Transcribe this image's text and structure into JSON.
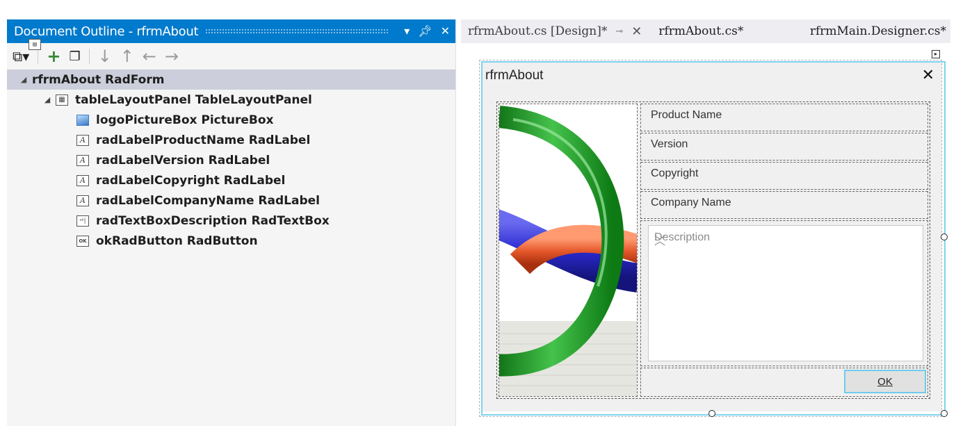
{
  "outline": {
    "title": "Document Outline - rfrmAbout",
    "title_buttons": [
      "dropdown-icon",
      "pin-icon",
      "close-icon"
    ],
    "toolbar": [
      {
        "icon": "view-toggle-icon",
        "enabled": true
      },
      {
        "icon": "add-icon",
        "enabled": true
      },
      {
        "icon": "copy-icon",
        "enabled": true
      },
      {
        "icon": "move-down-icon",
        "enabled": false
      },
      {
        "icon": "move-up-icon",
        "enabled": false
      },
      {
        "icon": "move-left-icon",
        "enabled": false
      },
      {
        "icon": "move-right-icon",
        "enabled": false
      }
    ],
    "tree": [
      {
        "label": "rfrmAbout  RadForm",
        "level": 0,
        "expanded": true,
        "selected": true,
        "icon": "form-icon"
      },
      {
        "label": "tableLayoutPanel  TableLayoutPanel",
        "level": 1,
        "expanded": true,
        "icon": "table-layout-icon"
      },
      {
        "label": "logoPictureBox  PictureBox",
        "level": 2,
        "icon": "picture-box-icon"
      },
      {
        "label": "radLabelProductName  RadLabel",
        "level": 2,
        "icon": "label-icon"
      },
      {
        "label": "radLabelVersion  RadLabel",
        "level": 2,
        "icon": "label-icon"
      },
      {
        "label": "radLabelCopyright  RadLabel",
        "level": 2,
        "icon": "label-icon"
      },
      {
        "label": "radLabelCompanyName  RadLabel",
        "level": 2,
        "icon": "label-icon"
      },
      {
        "label": "radTextBoxDescription  RadTextBox",
        "level": 2,
        "icon": "textbox-icon"
      },
      {
        "label": "okRadButton  RadButton",
        "level": 2,
        "icon": "button-icon"
      }
    ]
  },
  "tabs": [
    {
      "label": "rfrmAbout.cs [Design]*",
      "active": true
    },
    {
      "label": "rfrmAbout.cs*",
      "active": false
    },
    {
      "label": "rfrmMain.Designer.cs*",
      "active": false
    }
  ],
  "form": {
    "title": "rfrmAbout",
    "labels": [
      "Product Name",
      "Version",
      "Copyright",
      "Company Name"
    ],
    "description_placeholder": "Description",
    "ok_label": "OK"
  },
  "colors": {
    "accent": "#007acc",
    "selection_frame": "#7fd3ef",
    "tree_selected": "#cccedb"
  }
}
